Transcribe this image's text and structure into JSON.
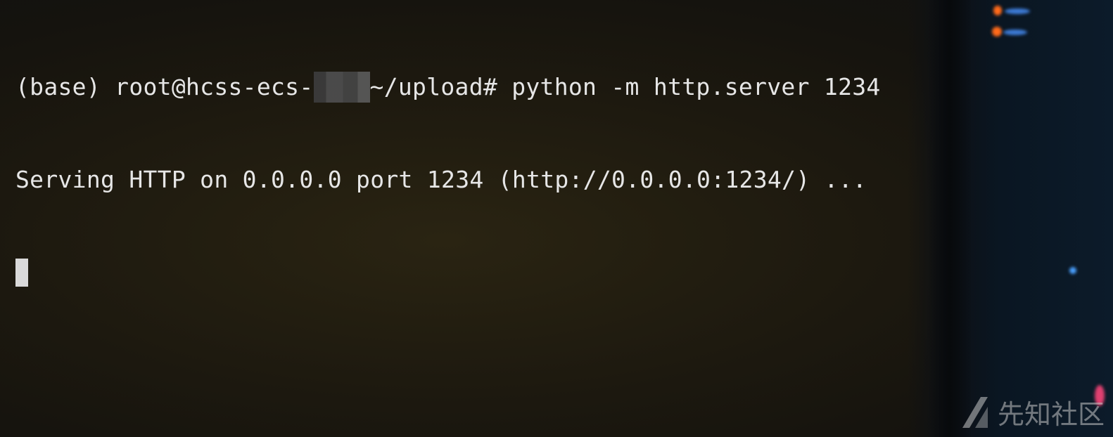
{
  "terminal": {
    "prompt_prefix": "(base) root@hcss-ecs-",
    "prompt_suffix": "~/upload# ",
    "command": "python -m http.server 1234",
    "output_line": "Serving HTTP on 0.0.0.0 port 1234 (http://0.0.0.0:1234/) ..."
  },
  "watermark": {
    "text": "先知社区"
  },
  "colors": {
    "background": "#191611",
    "text": "#e6e6e6",
    "cursor": "#d9d9d9"
  }
}
